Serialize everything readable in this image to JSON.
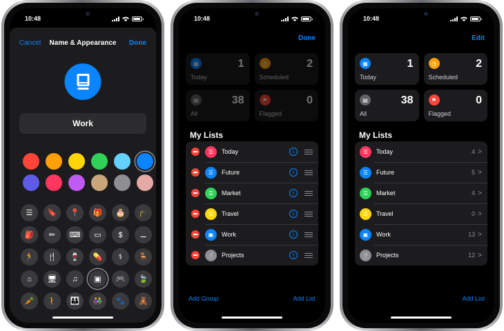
{
  "phone1": {
    "time": "10:48",
    "nav": {
      "cancel": "Cancel",
      "title": "Name & Appearance",
      "done": "Done"
    },
    "list_icon": "tv-book-icon",
    "name": "Work",
    "colors": [
      "#ff453a",
      "#ff9f0a",
      "#ffd60a",
      "#30d158",
      "#64d2ff",
      "#0a84ff",
      "#5e5ce6",
      "#ff375f",
      "#bf5af2",
      "#c8a57a",
      "#8e8e93",
      "#e5a8a2"
    ],
    "selected_color": 5,
    "icons": [
      {
        "name": "list-icon",
        "glyph": "☰"
      },
      {
        "name": "bookmark-icon",
        "glyph": "🔖"
      },
      {
        "name": "pin-icon",
        "glyph": "📍"
      },
      {
        "name": "gift-icon",
        "glyph": "🎁"
      },
      {
        "name": "cake-icon",
        "glyph": "🎂"
      },
      {
        "name": "graduation-cap-icon",
        "glyph": "🎓"
      },
      {
        "name": "backpack-icon",
        "glyph": "🎒"
      },
      {
        "name": "pencil-ruler-icon",
        "glyph": "✏"
      },
      {
        "name": "keyboard-icon",
        "glyph": "⌨"
      },
      {
        "name": "credit-card-icon",
        "glyph": "▭"
      },
      {
        "name": "money-icon",
        "glyph": "$"
      },
      {
        "name": "dumbbell-icon",
        "glyph": "⚊"
      },
      {
        "name": "runner-icon",
        "glyph": "🏃"
      },
      {
        "name": "fork-knife-icon",
        "glyph": "🍴"
      },
      {
        "name": "wine-glass-icon",
        "glyph": "🍷"
      },
      {
        "name": "pills-icon",
        "glyph": "💊"
      },
      {
        "name": "stethoscope-icon",
        "glyph": "⚕"
      },
      {
        "name": "chair-icon",
        "glyph": "🪑"
      },
      {
        "name": "house-icon",
        "glyph": "⌂"
      },
      {
        "name": "monitor-icon",
        "glyph": "🖥"
      },
      {
        "name": "music-note-icon",
        "glyph": "♫"
      },
      {
        "name": "computer-icon",
        "glyph": "▣"
      },
      {
        "name": "gamepad-icon",
        "glyph": "🎮"
      },
      {
        "name": "leaf-icon",
        "glyph": "🍃"
      },
      {
        "name": "carrot-icon",
        "glyph": "🥕"
      },
      {
        "name": "person-icon",
        "glyph": "🚶"
      },
      {
        "name": "family-icon",
        "glyph": "👪"
      },
      {
        "name": "people-icon",
        "glyph": "👫"
      },
      {
        "name": "paw-icon",
        "glyph": "🐾"
      },
      {
        "name": "teddy-bear-icon",
        "glyph": "🧸"
      }
    ],
    "selected_icon": 21
  },
  "phone2": {
    "time": "10:48",
    "top_button": "Done",
    "tiles": [
      {
        "label": "Today",
        "count": "1",
        "color": "#0a84ff",
        "icon": "calendar-icon",
        "glyph": "▦"
      },
      {
        "label": "Scheduled",
        "count": "2",
        "color": "#ff9f0a",
        "icon": "clock-icon",
        "glyph": "◷"
      },
      {
        "label": "All",
        "count": "38",
        "color": "#636366",
        "icon": "tray-icon",
        "glyph": "▤"
      },
      {
        "label": "Flagged",
        "count": "0",
        "color": "#ff453a",
        "icon": "flag-icon",
        "glyph": "⚑"
      }
    ],
    "section_title": "My Lists",
    "lists": [
      {
        "name": "Today",
        "color": "#ff375f",
        "icon": "list-icon",
        "glyph": "☰"
      },
      {
        "name": "Future",
        "color": "#0a84ff",
        "icon": "list-icon",
        "glyph": "☰"
      },
      {
        "name": "Market",
        "color": "#30d158",
        "icon": "list-icon",
        "glyph": "☰"
      },
      {
        "name": "Travel",
        "color": "#ffd60a",
        "icon": "list-icon",
        "glyph": "☰"
      },
      {
        "name": "Work",
        "color": "#0a84ff",
        "icon": "computer-icon",
        "glyph": "▣"
      },
      {
        "name": "Projects",
        "color": "#8e8e93",
        "icon": "fork-knife-icon",
        "glyph": "🍴"
      }
    ],
    "info_glyph": "i",
    "add_group": "Add Group",
    "add_list": "Add List"
  },
  "phone3": {
    "time": "10:48",
    "top_button": "Edit",
    "tiles": [
      {
        "label": "Today",
        "count": "1",
        "color": "#0a84ff",
        "icon": "calendar-icon",
        "glyph": "▦"
      },
      {
        "label": "Scheduled",
        "count": "2",
        "color": "#ff9f0a",
        "icon": "clock-icon",
        "glyph": "◷"
      },
      {
        "label": "All",
        "count": "38",
        "color": "#636366",
        "icon": "tray-icon",
        "glyph": "▤"
      },
      {
        "label": "Flagged",
        "count": "0",
        "color": "#ff453a",
        "icon": "flag-icon",
        "glyph": "⚑"
      }
    ],
    "section_title": "My Lists",
    "lists": [
      {
        "name": "Today",
        "count": "4",
        "color": "#ff375f",
        "icon": "list-icon",
        "glyph": "☰"
      },
      {
        "name": "Future",
        "count": "5",
        "color": "#0a84ff",
        "icon": "list-icon",
        "glyph": "☰"
      },
      {
        "name": "Market",
        "count": "4",
        "color": "#30d158",
        "icon": "list-icon",
        "glyph": "☰"
      },
      {
        "name": "Travel",
        "count": "0",
        "color": "#ffd60a",
        "icon": "list-icon",
        "glyph": "☰"
      },
      {
        "name": "Work",
        "count": "13",
        "color": "#0a84ff",
        "icon": "computer-icon",
        "glyph": "▣"
      },
      {
        "name": "Projects",
        "count": "12",
        "color": "#8e8e93",
        "icon": "fork-knife-icon",
        "glyph": "🍴"
      }
    ],
    "chevron": ">",
    "add_list": "Add List"
  }
}
